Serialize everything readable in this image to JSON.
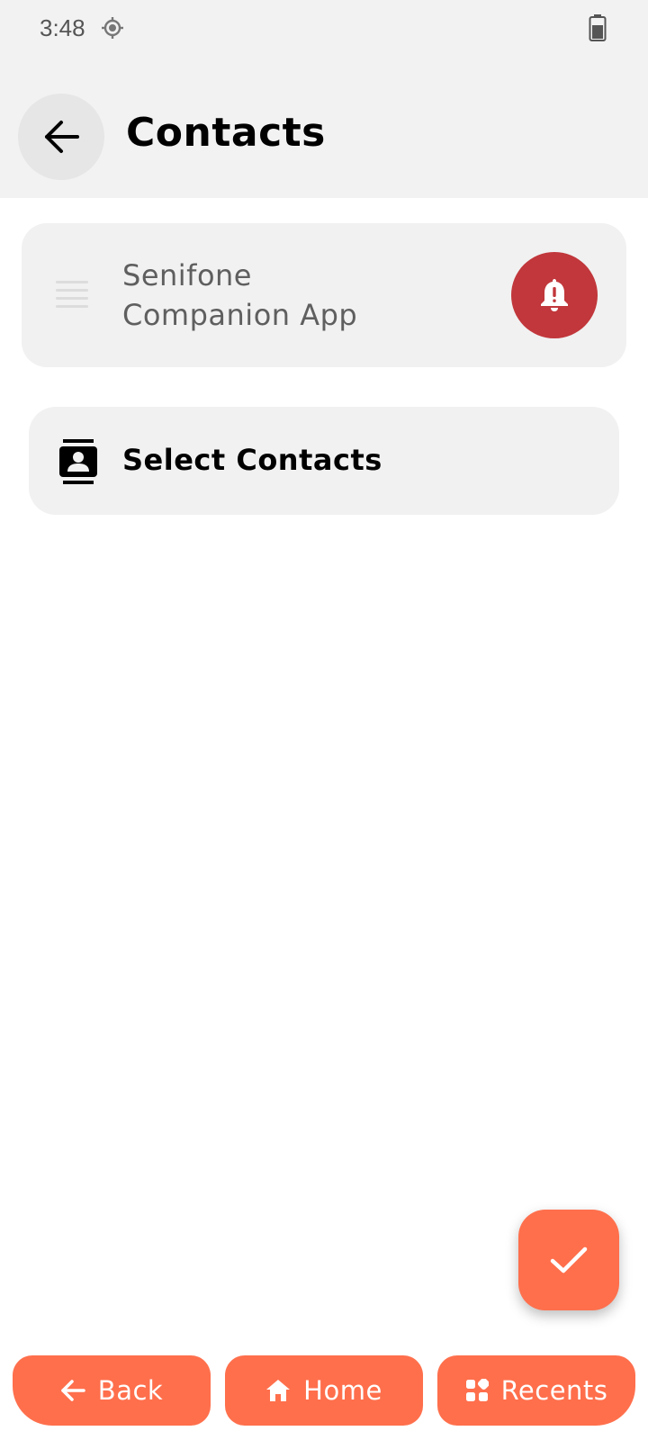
{
  "status_bar": {
    "time": "3:48",
    "location_icon": "location-target-icon",
    "battery_icon": "battery-icon"
  },
  "app_bar": {
    "back_icon": "arrow-left-icon",
    "title": "Contacts"
  },
  "app_card": {
    "drag_icon": "drag-handle-icon",
    "name_line1": "Senifone",
    "name_line2": "Companion App",
    "alert_icon": "bell-alert-icon",
    "alert_color": "#c1373b"
  },
  "select_card": {
    "icon": "contacts-icon",
    "label": "Select Contacts"
  },
  "fab": {
    "icon": "check-icon"
  },
  "bottom_nav": {
    "back_label": "Back",
    "home_label": "Home",
    "recents_label": "Recents"
  },
  "colors": {
    "accent": "#ff6f4c",
    "card_bg": "#f1f1f1",
    "header_bg": "#f2f2f2"
  }
}
